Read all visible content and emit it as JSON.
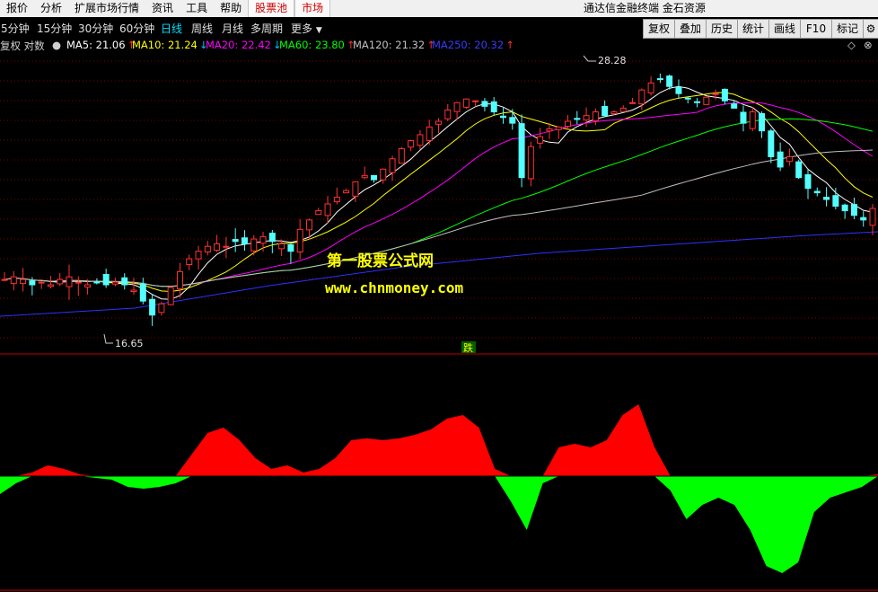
{
  "menu": {
    "items": [
      "报价",
      "分析",
      "扩展市场行情",
      "资讯",
      "工具",
      "帮助"
    ],
    "highlight_items": [
      "股票池",
      "市场"
    ],
    "app_title": "通达信金融终端 金石资源"
  },
  "toolbar": {
    "periods": [
      "5分钟",
      "15分钟",
      "30分钟",
      "60分钟",
      "日线",
      "周线",
      "月线",
      "多周期",
      "更多"
    ],
    "active_period": "日线",
    "right_buttons": [
      "复权",
      "叠加",
      "历史",
      "统计",
      "画线",
      "F10",
      "标记"
    ]
  },
  "chart_header": {
    "adjust_mode": "复权 对数",
    "ma": [
      {
        "label": "MA5: 21.06",
        "color": "#ffffff",
        "trend": "up"
      },
      {
        "label": "MA10: 21.24",
        "color": "#ffff00",
        "trend": "down"
      },
      {
        "label": "MA20: 22.42",
        "color": "#ff00ff",
        "trend": "down"
      },
      {
        "label": "MA60: 23.80",
        "color": "#00ff00",
        "trend": "up"
      },
      {
        "label": "MA120: 21.32",
        "color": "#c0c0c0",
        "trend": "up"
      },
      {
        "label": "MA250: 20.32",
        "color": "#3030ff",
        "trend": "up"
      }
    ]
  },
  "price_annotations": {
    "high": "28.28",
    "low": "16.65",
    "signal": "跌"
  },
  "watermark": {
    "line1": "第一股票公式网",
    "line2": "www.chnmoney.com"
  },
  "colors": {
    "up": "#ff3232",
    "down": "#54ffff",
    "positive_area": "#ff0000",
    "negative_area": "#00ff00"
  },
  "chart_data": {
    "type": "candlestick",
    "title": "",
    "price_range": [
      16.65,
      28.28
    ],
    "indicator": {
      "type": "area",
      "values": [
        -0.5,
        -0.2,
        0.1,
        0.3,
        0.2,
        0.05,
        -0.05,
        -0.1,
        -0.3,
        -0.35,
        -0.3,
        -0.2,
        0.6,
        1.2,
        1.35,
        1.0,
        0.5,
        0.2,
        0.3,
        0.1,
        0.2,
        0.5,
        1.0,
        1.05,
        1.0,
        1.05,
        1.15,
        1.3,
        1.6,
        1.7,
        1.35,
        0.2,
        -0.7,
        -1.5,
        -0.2,
        0.8,
        0.9,
        0.8,
        1.0,
        1.7,
        2.0,
        0.8,
        -0.4,
        -1.2,
        -0.8,
        -0.6,
        -0.8,
        -1.5,
        -2.5,
        -2.7,
        -2.4,
        -1.0,
        -0.6,
        -0.45,
        -0.3,
        0.05
      ]
    }
  }
}
